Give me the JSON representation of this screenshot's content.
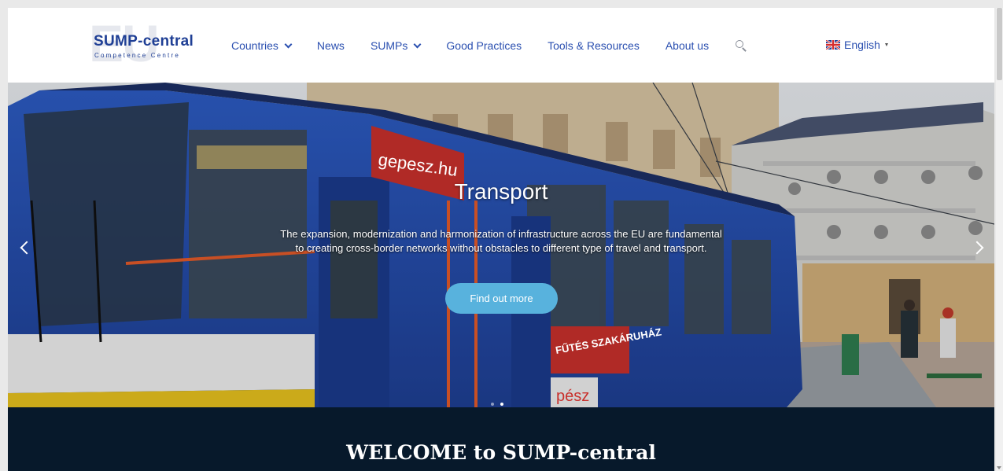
{
  "header": {
    "logo": {
      "name": "SUMP-central",
      "subtitle": "Competence Centre",
      "watermark": "EU"
    },
    "nav": [
      {
        "label": "Countries",
        "dropdown": true
      },
      {
        "label": "News",
        "dropdown": false
      },
      {
        "label": "SUMPs",
        "dropdown": true
      },
      {
        "label": "Good Practices",
        "dropdown": false
      },
      {
        "label": "Tools & Resources",
        "dropdown": false
      },
      {
        "label": "About us",
        "dropdown": false
      }
    ],
    "search_icon": "search-icon",
    "language": {
      "label": "English",
      "flag": "uk-flag-icon"
    }
  },
  "hero": {
    "title": "Transport",
    "text_line1": "The expansion, modernization and harmonization of infrastructure across the EU are fundamental",
    "text_line2": "to creating cross-border networks without obstacles to different type of travel and transport.",
    "cta_label": "Find out more",
    "slide_count": 2,
    "active_slide": 2,
    "tram_ad_text": "gepesz.hu",
    "tram_side_text": "FŰTÉS SZAKÁRUHÁZ",
    "tram_bottom_text": "pész"
  },
  "welcome": {
    "title": "WELCOME to SUMP-central"
  },
  "colors": {
    "brand": "#1f3f95",
    "nav": "#2a4fb0",
    "cta": "#58b2dd",
    "footer_bg": "#07192b"
  }
}
